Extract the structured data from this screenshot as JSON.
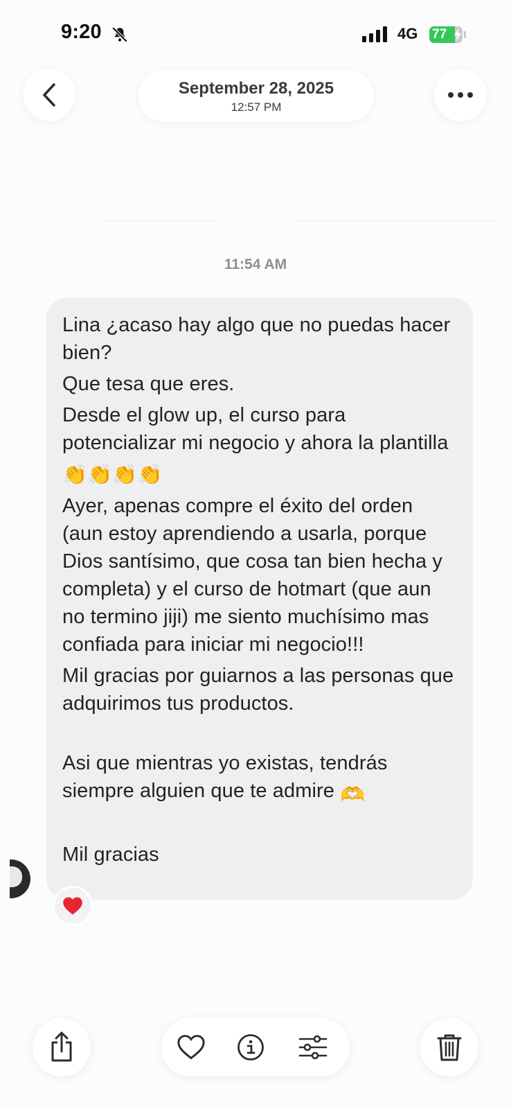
{
  "status_bar": {
    "time": "9:20",
    "network": "4G",
    "battery_level": "77",
    "battery_fraction": 0.77,
    "battery_color": "#34c759"
  },
  "header": {
    "date": "September 28, 2025",
    "time": "12:57 PM",
    "back_icon": "chevron-left-icon",
    "more_icon": "ellipsis-icon"
  },
  "conversation": {
    "timestamp": "11:54 AM",
    "message": {
      "lines": [
        "Lina ¿acaso hay algo que no puedas hacer bien?",
        "Que tesa que eres.",
        "Desde el glow up, el curso para potencializar mi negocio y ahora la plantilla",
        "Ayer, apenas compre el éxito del orden (aun estoy aprendiendo a usarla, porque Dios santísimo, que cosa tan bien hecha y completa) y el curso de hotmart (que aun no termino jiji) me siento muchísimo mas confiada para iniciar mi negocio!!!",
        "Mil gracias por guiarnos a las personas que adquirimos tus productos.",
        "Asi que mientras yo existas, tendrás siempre alguien que te admire",
        "Mil gracias"
      ],
      "emoji_clapping": "👏👏👏👏",
      "emoji_heart_hands": "🫶",
      "bubble_color": "#efeff2"
    },
    "reaction": "heart-icon"
  },
  "toolbar": {
    "share_icon": "share-icon",
    "favorite_icon": "heart-outline-icon",
    "info_icon": "info-icon",
    "adjust_icon": "sliders-icon",
    "delete_icon": "trash-icon"
  }
}
